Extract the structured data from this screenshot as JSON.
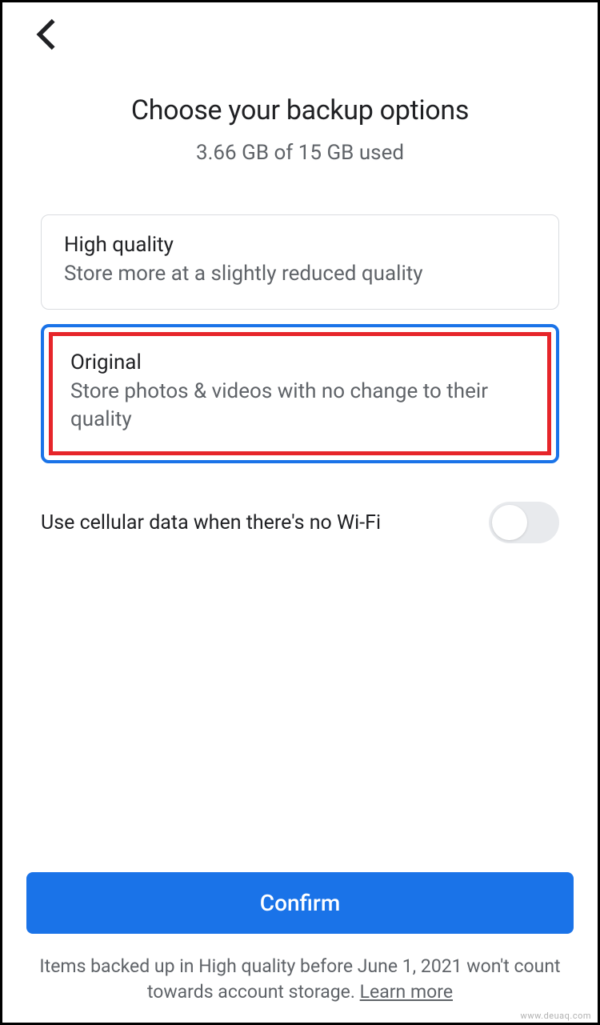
{
  "header": {
    "title": "Choose your backup options",
    "subtitle": "3.66 GB of 15 GB used"
  },
  "options": [
    {
      "title": "High quality",
      "desc": "Store more at a slightly reduced quality"
    },
    {
      "title": "Original",
      "desc": "Store photos & videos with no change to their quality"
    }
  ],
  "cellular": {
    "label": "Use cellular data when there's no Wi-Fi",
    "enabled": false
  },
  "confirm_button": "Confirm",
  "footer": {
    "text": "Items backed up in High quality before June 1, 2021 won't count towards account storage. ",
    "learn_more": "Learn more"
  },
  "watermark": "www.deuaq.com"
}
